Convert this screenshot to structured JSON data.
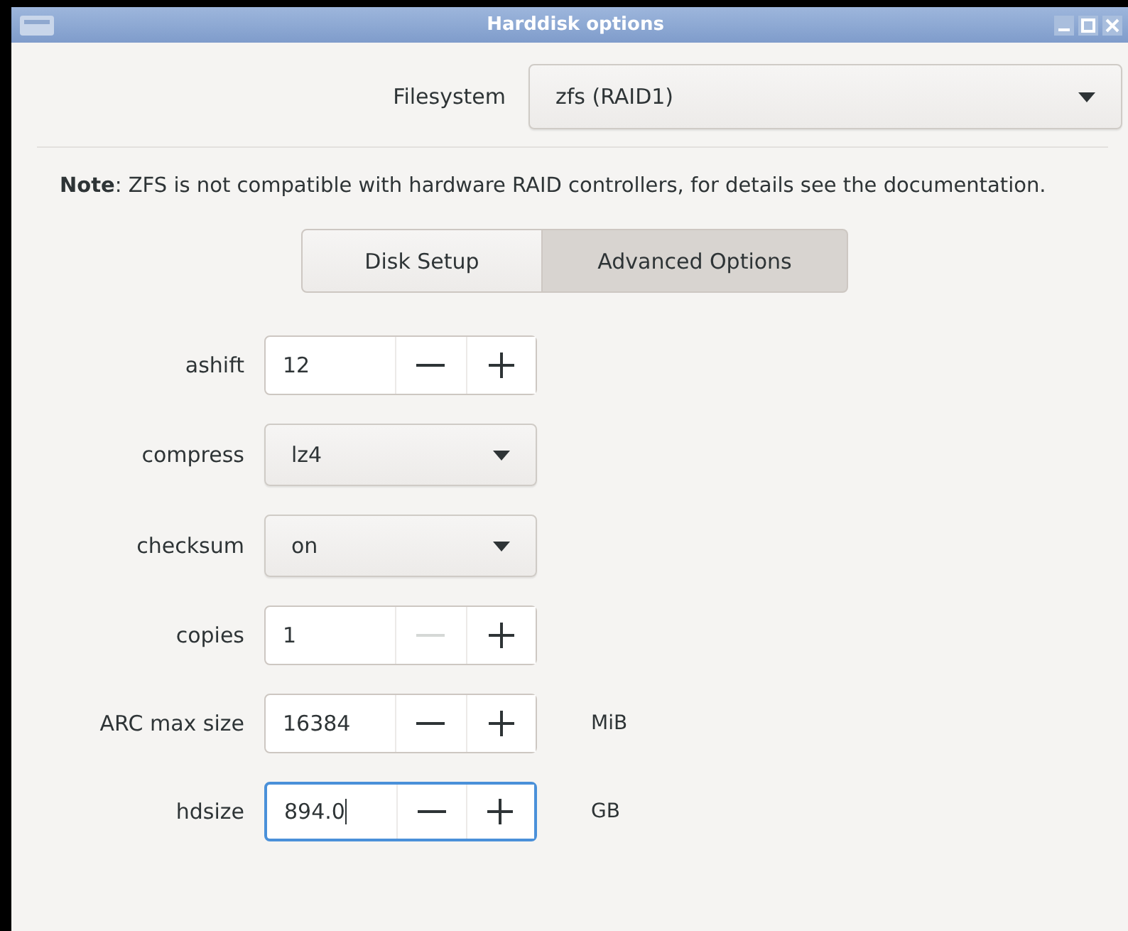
{
  "window": {
    "title": "Harddisk options"
  },
  "filesystem": {
    "label": "Filesystem",
    "value": "zfs (RAID1)"
  },
  "note": "**Note**: ZFS is not compatible with hardware RAID controllers, for details see the documentation.",
  "tabs": [
    {
      "label": "Disk Setup",
      "selected": false
    },
    {
      "label": "Advanced Options",
      "selected": true
    }
  ],
  "options": [
    {
      "kind": "spin",
      "label": "ashift",
      "value": "12",
      "minus_disabled": false,
      "focused": false
    },
    {
      "kind": "combo",
      "label": "compress",
      "value": "lz4"
    },
    {
      "kind": "combo",
      "label": "checksum",
      "value": "on"
    },
    {
      "kind": "spin",
      "label": "copies",
      "value": "1",
      "minus_disabled": true,
      "focused": false
    },
    {
      "kind": "spin",
      "label": "ARC max size",
      "value": "16384",
      "minus_disabled": false,
      "focused": false,
      "unit": "MiB"
    },
    {
      "kind": "spin",
      "label": "hdsize",
      "value": "894.0",
      "minus_disabled": false,
      "focused": true,
      "unit": "GB"
    }
  ]
}
